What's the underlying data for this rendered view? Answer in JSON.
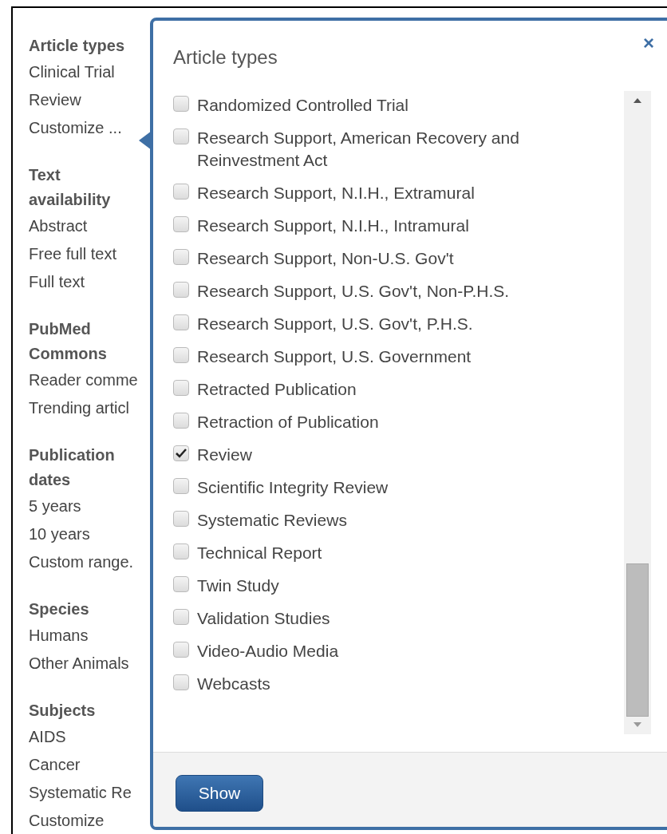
{
  "sidebar": [
    {
      "heading": "Article types",
      "items": [
        "Clinical Trial",
        "Review",
        "Customize ..."
      ]
    },
    {
      "heading": "Text availability",
      "items": [
        "Abstract",
        "Free full text",
        "Full text"
      ]
    },
    {
      "heading": "PubMed Commons",
      "items": [
        "Reader comme",
        "Trending articl"
      ]
    },
    {
      "heading": "Publication dates",
      "items": [
        "5 years",
        "10 years",
        "Custom range."
      ]
    },
    {
      "heading": "Species",
      "items": [
        "Humans",
        "Other Animals"
      ]
    },
    {
      "heading": "Subjects",
      "items": [
        "AIDS",
        "Cancer",
        "Systematic Re",
        "Customize"
      ]
    }
  ],
  "popup": {
    "title": "Article types",
    "close": "×",
    "options": [
      {
        "label": "Randomized Controlled Trial",
        "checked": false
      },
      {
        "label": "Research Support, American Recovery and Reinvestment Act",
        "checked": false
      },
      {
        "label": "Research Support, N.I.H., Extramural",
        "checked": false
      },
      {
        "label": "Research Support, N.I.H., Intramural",
        "checked": false
      },
      {
        "label": "Research Support, Non-U.S. Gov't",
        "checked": false
      },
      {
        "label": "Research Support, U.S. Gov't, Non-P.H.S.",
        "checked": false
      },
      {
        "label": "Research Support, U.S. Gov't, P.H.S.",
        "checked": false
      },
      {
        "label": "Research Support, U.S. Government",
        "checked": false
      },
      {
        "label": "Retracted Publication",
        "checked": false
      },
      {
        "label": "Retraction of Publication",
        "checked": false
      },
      {
        "label": "Review",
        "checked": true
      },
      {
        "label": "Scientific Integrity Review",
        "checked": false
      },
      {
        "label": "Systematic Reviews",
        "checked": false
      },
      {
        "label": "Technical Report",
        "checked": false
      },
      {
        "label": "Twin Study",
        "checked": false
      },
      {
        "label": "Validation Studies",
        "checked": false
      },
      {
        "label": "Video-Audio Media",
        "checked": false
      },
      {
        "label": "Webcasts",
        "checked": false
      }
    ],
    "button": "Show"
  }
}
